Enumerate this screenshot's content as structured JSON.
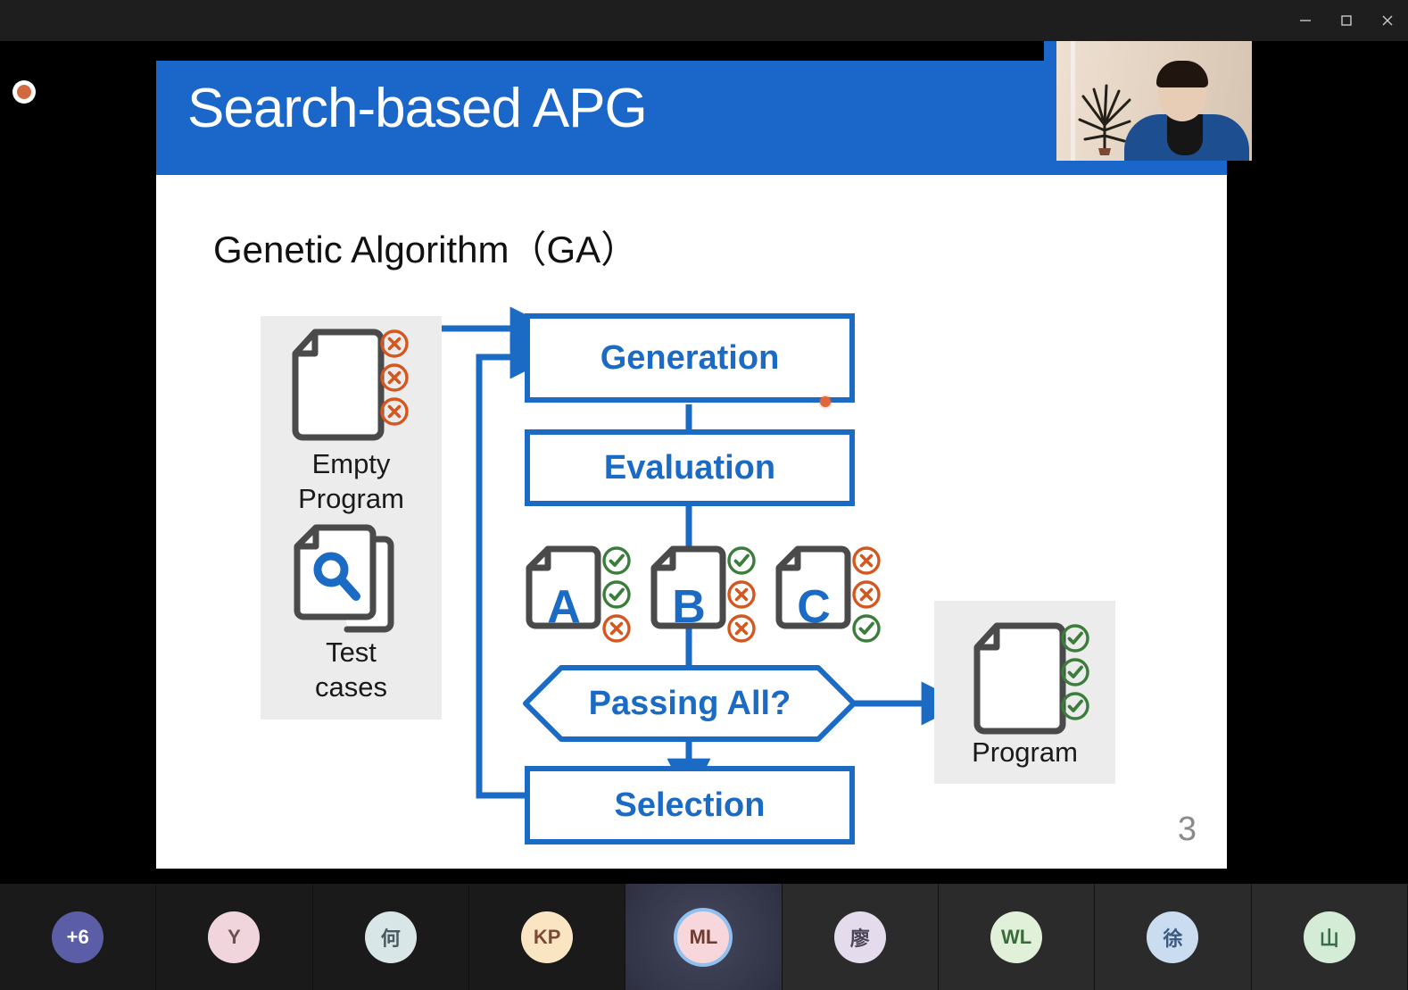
{
  "window": {
    "controls": [
      {
        "name": "minimize-button",
        "glyph": "—"
      },
      {
        "name": "maximize-button",
        "glyph": "□"
      },
      {
        "name": "close-button",
        "glyph": "✕"
      }
    ]
  },
  "recording": {
    "label": "recording-indicator",
    "color": "#d2693f"
  },
  "slide": {
    "title": "Search-based APG",
    "subtitle": "Genetic Algorithm（GA）",
    "number": "3",
    "header_color": "#1b66c9",
    "accent_color": "#1b6ac4",
    "pass_color": "#3b7d3b",
    "fail_color": "#d4571f",
    "doc_outline_color": "#4a4a4a"
  },
  "flow": {
    "inputs": {
      "empty_program_label_line1": "Empty",
      "empty_program_label_line2": "Program",
      "empty_program_results": [
        "fail",
        "fail",
        "fail"
      ],
      "test_cases_label_line1": "Test",
      "test_cases_label_line2": "cases"
    },
    "steps": {
      "generation": "Generation",
      "evaluation": "Evaluation",
      "decision": "Passing All?",
      "selection": "Selection"
    },
    "candidates": [
      {
        "letter": "A",
        "results": [
          "pass",
          "pass",
          "fail"
        ]
      },
      {
        "letter": "B",
        "results": [
          "pass",
          "fail",
          "fail"
        ]
      },
      {
        "letter": "C",
        "results": [
          "fail",
          "fail",
          "pass"
        ]
      }
    ],
    "output": {
      "label": "Program",
      "results": [
        "pass",
        "pass",
        "pass"
      ]
    }
  },
  "participants": [
    {
      "initials": "+6",
      "bg": "#5b5ea6",
      "fg": "#ffffff",
      "tile": "plain",
      "active": false
    },
    {
      "initials": "Y",
      "bg": "#f0d6dc",
      "fg": "#6a5050",
      "tile": "plain",
      "active": false
    },
    {
      "initials": "何",
      "bg": "#d9e6e8",
      "fg": "#4a5a60",
      "tile": "plain",
      "active": false
    },
    {
      "initials": "KP",
      "bg": "#fae5c3",
      "fg": "#7c4a34",
      "tile": "plain",
      "active": false
    },
    {
      "initials": "ML",
      "bg": "#f7d7dc",
      "fg": "#6e3b30",
      "tile": "active",
      "active": true
    },
    {
      "initials": "廖",
      "bg": "#e4dced",
      "fg": "#4a4458",
      "tile": "dim",
      "active": false
    },
    {
      "initials": "WL",
      "bg": "#e1f0d8",
      "fg": "#3a6b3a",
      "tile": "dim",
      "active": false
    },
    {
      "initials": "徐",
      "bg": "#c9dcf0",
      "fg": "#3c5a80",
      "tile": "dim",
      "active": false
    },
    {
      "initials": "山",
      "bg": "#d4ecd6",
      "fg": "#3b6b4a",
      "tile": "dim",
      "active": false
    }
  ]
}
